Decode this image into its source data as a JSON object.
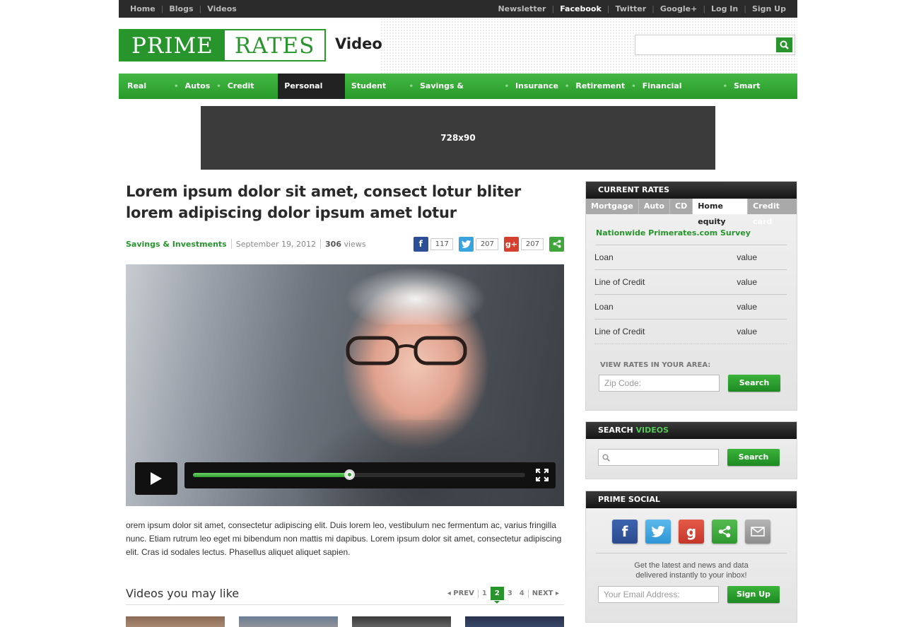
{
  "topbar": {
    "left_links": [
      "Home",
      "Blogs",
      "Videos"
    ],
    "right_links": [
      "Newsletter",
      "Facebook",
      "Twitter",
      "Google+",
      "Log In",
      "Sign Up"
    ]
  },
  "header": {
    "logo_part1": "PRIME",
    "logo_part2": "RATES",
    "section": "Video",
    "search_placeholder": ""
  },
  "nav": {
    "items": [
      "Real Estate",
      "Autos",
      "Credit Cards",
      "Personal Loans",
      "Student Loans",
      "Savings & Investment",
      "Insurance",
      "Retirement",
      "Financial Calculators",
      "Smart Spending"
    ],
    "active": "Personal Loans"
  },
  "ad": {
    "label": "728x90"
  },
  "article": {
    "title": "Lorem ipsum dolor sit amet, consect lotur bliter lorem adipiscing dolor ipsum amet lotur",
    "category": "Savings & Investments",
    "date": "September 19, 2012",
    "views_count": "306",
    "views_label": "views",
    "share": {
      "facebook_count": "117",
      "twitter_count": "207",
      "google_count": "207"
    },
    "video_progress": 0.47,
    "description": "orem ipsum dolor sit amet, consectetur adipiscing elit. Duis lorem leo, vestibulum nec fermentum ac, varius fringilla nunc. Etiam rutrum leo eget mi bibendum non mattis mi dapibus. Lorem ipsum dolor sit amet, consectetur adipiscing elit. Cras id sodales lectus. Phasellus aliquet aliquet sapien."
  },
  "related": {
    "heading": "Videos you may like",
    "prev": "PREV",
    "next": "NEXT",
    "pages": [
      "1",
      "2",
      "3",
      "4"
    ],
    "current_page": "2"
  },
  "rates": {
    "heading": "CURRENT RATES",
    "tabs": [
      "Mortgage",
      "Auto",
      "CD",
      "Home equity",
      "Credit card"
    ],
    "active_tab": "Home equity",
    "survey": "Nationwide Primerates.com Survey",
    "rows": [
      {
        "label": "Loan",
        "value": "value"
      },
      {
        "label": "Line of Credit",
        "value": "value"
      },
      {
        "label": "Loan",
        "value": "value"
      },
      {
        "label": "Line of Credit",
        "value": "value"
      }
    ],
    "view_rates_label": "VIEW RATES IN YOUR AREA:",
    "zip_placeholder": "Zip Code:",
    "search_label": "Search"
  },
  "search_videos": {
    "heading_part1": "SEARCH",
    "heading_part2": "VIDEOS",
    "search_label": "Search"
  },
  "social": {
    "heading": "PRIME SOCIAL",
    "icons": [
      "facebook-icon",
      "twitter-icon",
      "google-plus-icon",
      "share-icon",
      "mail-icon"
    ],
    "text_line1": "Get the latest and news and data",
    "text_line2": "delivered instantly to your inbox!",
    "email_placeholder": "Your Email Address:",
    "signup_label": "Sign Up"
  },
  "colors": {
    "brand_green": "#27952b",
    "nav_active": "#222222",
    "facebook": "#2d4f96",
    "twitter": "#39a3e0",
    "google": "#d6402f",
    "share": "#3ea63a",
    "mail": "#9a9a9a"
  }
}
